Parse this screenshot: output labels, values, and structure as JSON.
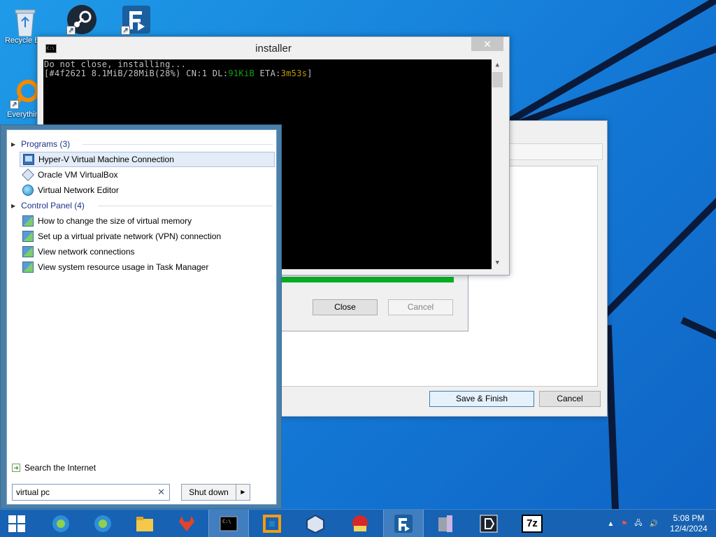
{
  "desktop": {
    "icons": [
      {
        "label": "Recycle Bin"
      },
      {
        "label": "Steam"
      },
      {
        "label": "FreeFileSync"
      },
      {
        "label": "Everything"
      }
    ]
  },
  "console": {
    "title": "installer",
    "close_glyph": "✕",
    "line1": "Do not close, installing...",
    "line2_prefix": "[#4f2621 8.1MiB/28MiB(28%) CN:1 DL:",
    "line2_dl": "91KiB",
    "line2_mid": " ETA:",
    "line2_eta": "3m53s",
    "line2_end": "]"
  },
  "progress_dialog": {
    "progress_percent": 100,
    "close_label": "Close",
    "cancel_label": "Cancel"
  },
  "back_dialog": {
    "save_label": "Save & Finish",
    "cancel_label": "Cancel"
  },
  "start_menu": {
    "programs_header": "Programs (3)",
    "programs": [
      {
        "label": "Hyper-V Virtual Machine Connection",
        "icon": "monitor-icon"
      },
      {
        "label": "Oracle VM VirtualBox",
        "icon": "virtualbox-icon"
      },
      {
        "label": "Virtual Network Editor",
        "icon": "globe-icon"
      }
    ],
    "control_header": "Control Panel (4)",
    "control": [
      {
        "label": "How to change the size of virtual memory"
      },
      {
        "label": "Set up a virtual private network (VPN) connection"
      },
      {
        "label": "View network connections"
      },
      {
        "label": "View system resource usage in Task Manager"
      }
    ],
    "search_internet": "Search the Internet",
    "search_value": "virtual pc",
    "shutdown_label": "Shut down"
  },
  "taskbar": {
    "clock_time": "5:08 PM",
    "clock_date": "12/4/2024",
    "apps": [
      "browser-1",
      "browser-2",
      "file-explorer",
      "gitlab",
      "cmd",
      "installer",
      "virtualbox",
      "app-red",
      "freefilesync",
      "app-grey",
      "app-dark",
      "7-zip"
    ],
    "seven_zip": "7z"
  }
}
